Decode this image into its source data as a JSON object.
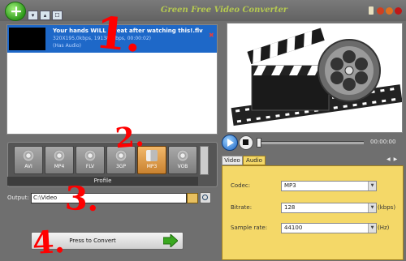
{
  "app": {
    "title": "Green Free Video Converter"
  },
  "toolbar": {
    "add_symbol": "+",
    "down_symbol": "▾",
    "up_symbol": "▴",
    "misc_symbol": "☐"
  },
  "file_list": {
    "items": [
      {
        "name": "Your hands WILL sweat after watching this!.flv",
        "info": "320X195,0kbps, 191385kbps, 00:00:02)",
        "audio": "(Has Audio)"
      }
    ]
  },
  "profiles": [
    {
      "label": "AVI",
      "selected": false
    },
    {
      "label": "MP4",
      "selected": false
    },
    {
      "label": "FLV",
      "selected": false
    },
    {
      "label": "3GP",
      "selected": false
    },
    {
      "label": "MP3",
      "selected": true
    },
    {
      "label": "VOB",
      "selected": false
    }
  ],
  "profile_label": "Profile",
  "output": {
    "label": "Output:",
    "path": "C:\\Video"
  },
  "convert": {
    "label": "Press to Convert"
  },
  "player": {
    "time": "00:00:00"
  },
  "tabs": [
    {
      "label": "Video",
      "active": false
    },
    {
      "label": "Audio",
      "active": true
    }
  ],
  "settings": {
    "codec": {
      "label": "Codec:",
      "value": "MP3"
    },
    "bitrate": {
      "label": "Bitrate:",
      "value": "128",
      "unit": "(kbps)"
    },
    "sample_rate": {
      "label": "Sample rate:",
      "value": "44100",
      "unit": "(Hz)"
    }
  },
  "annotations": {
    "one": "1.",
    "two": "2.",
    "three": "3.",
    "four": "4."
  },
  "colors": {
    "accent_blue": "#1e68c8",
    "audio_tab": "#f4d868",
    "annotation": "#ff0000",
    "title": "#b5c950"
  }
}
